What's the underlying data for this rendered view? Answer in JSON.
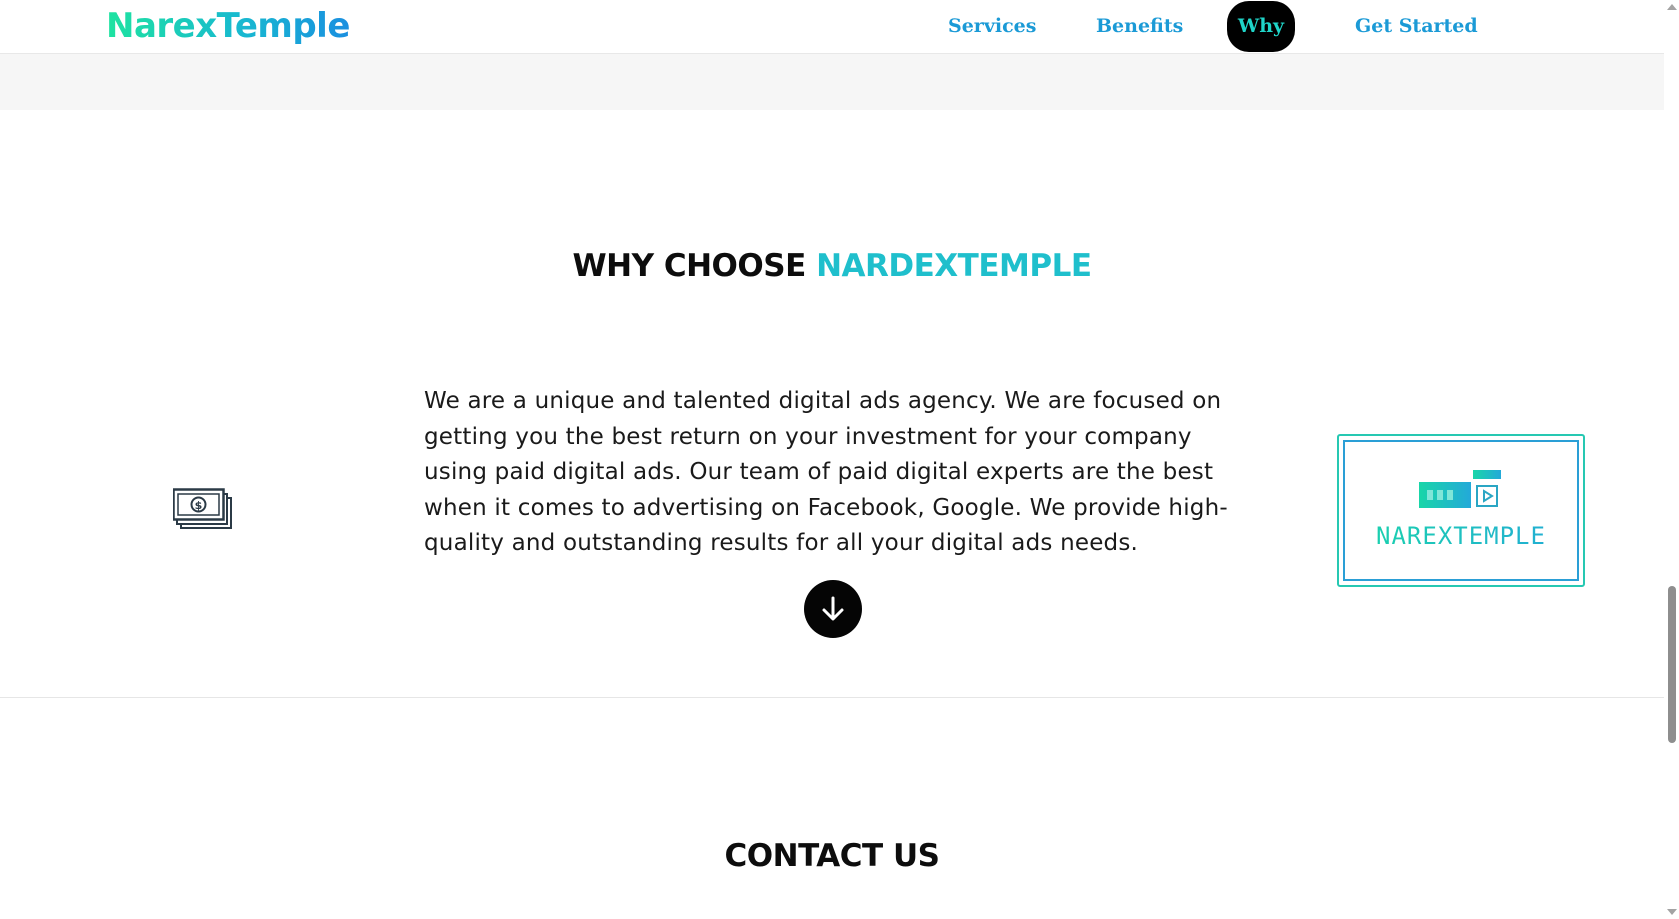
{
  "header": {
    "logo": "NarexTemple",
    "nav": {
      "services": "Services",
      "benefits": "Benefits",
      "why": "Why",
      "get_started": "Get Started"
    },
    "active_nav": "Why"
  },
  "why_section": {
    "title_prefix": "WHY CHOOSE ",
    "title_accent": "NARDEXTEMPLE",
    "body": "We are a unique and talented digital ads agency. We are focused on getting you the best return on your investment for your company using paid digital ads. Our team of paid digital experts are the best when it comes to advertising on Facebook, Google. We provide high-quality and outstanding results for all your digital ads needs.",
    "brand_card_text": "NAREXTEMPLE",
    "icons": {
      "money": "money-stack-icon",
      "down": "arrow-down-icon"
    }
  },
  "contact_section": {
    "title": "CONTACT US"
  },
  "colors": {
    "accent": "#1fbfcc",
    "nav_link": "#1b9ad6",
    "active_nav_bg": "#000000",
    "active_nav_text": "#1fd4c8"
  }
}
